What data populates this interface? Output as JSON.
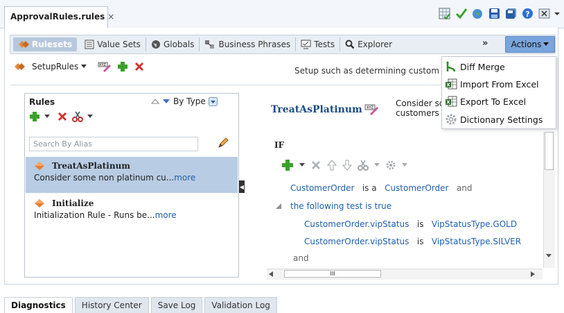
{
  "file_tab": {
    "label": "ApprovalRules.rules",
    "close": "×"
  },
  "top_icons": [
    "grid-check-icon",
    "validate-check-icon",
    "globe-icon",
    "save-icon",
    "save-all-icon",
    "help-icon",
    "close-window-icon",
    "dropdown-arrow-icon"
  ],
  "toolbar": {
    "rulesets": "Rulesets",
    "value_sets": "Value Sets",
    "globals": "Globals",
    "business_phrases": "Business Phrases",
    "tests": "Tests",
    "explorer": "Explorer",
    "more": "»",
    "actions": "Actions"
  },
  "setup": {
    "ruleset_name": "SetupRules",
    "description": "Setup such as determining custom"
  },
  "rules_panel": {
    "title": "Rules",
    "sort_label": "By Type",
    "search_placeholder": "Search By Alias",
    "items": [
      {
        "name": "TreatAsPlatinum",
        "desc": "Consider some non platinum cu...",
        "more": "more"
      },
      {
        "name": "Initialize",
        "desc": "Initialization Rule - Runs be...",
        "more": "more"
      }
    ]
  },
  "detail": {
    "title": "TreatAsPlatinum",
    "desc_line1": "Consider so",
    "desc_line2": "customers",
    "if_label": "IF",
    "conditions": [
      {
        "a": "CustomerOrder",
        "op": "is a",
        "b": "CustomerOrder",
        "tail": "and"
      },
      {
        "text": "the following test is true"
      },
      {
        "a": "CustomerOrder.vipStatus",
        "op": "is",
        "b": "VipStatusType.GOLD"
      },
      {
        "a": "CustomerOrder.vipStatus",
        "op": "is",
        "b": "VipStatusType.SILVER"
      },
      {
        "text": "and"
      }
    ],
    "hscroll_grip": "III"
  },
  "actions_menu": [
    {
      "label": "Diff Merge"
    },
    {
      "label": "Import From Excel"
    },
    {
      "label": "Export To Excel"
    },
    {
      "label": "Dictionary Settings"
    }
  ],
  "bottom_tabs": [
    "Diagnostics",
    "History Center",
    "Save Log",
    "Validation Log"
  ],
  "colors": {
    "accent": "#7aa5dc",
    "selected_row": "#b8cce4",
    "link": "#1f5fb0",
    "title": "#1c4c83"
  }
}
